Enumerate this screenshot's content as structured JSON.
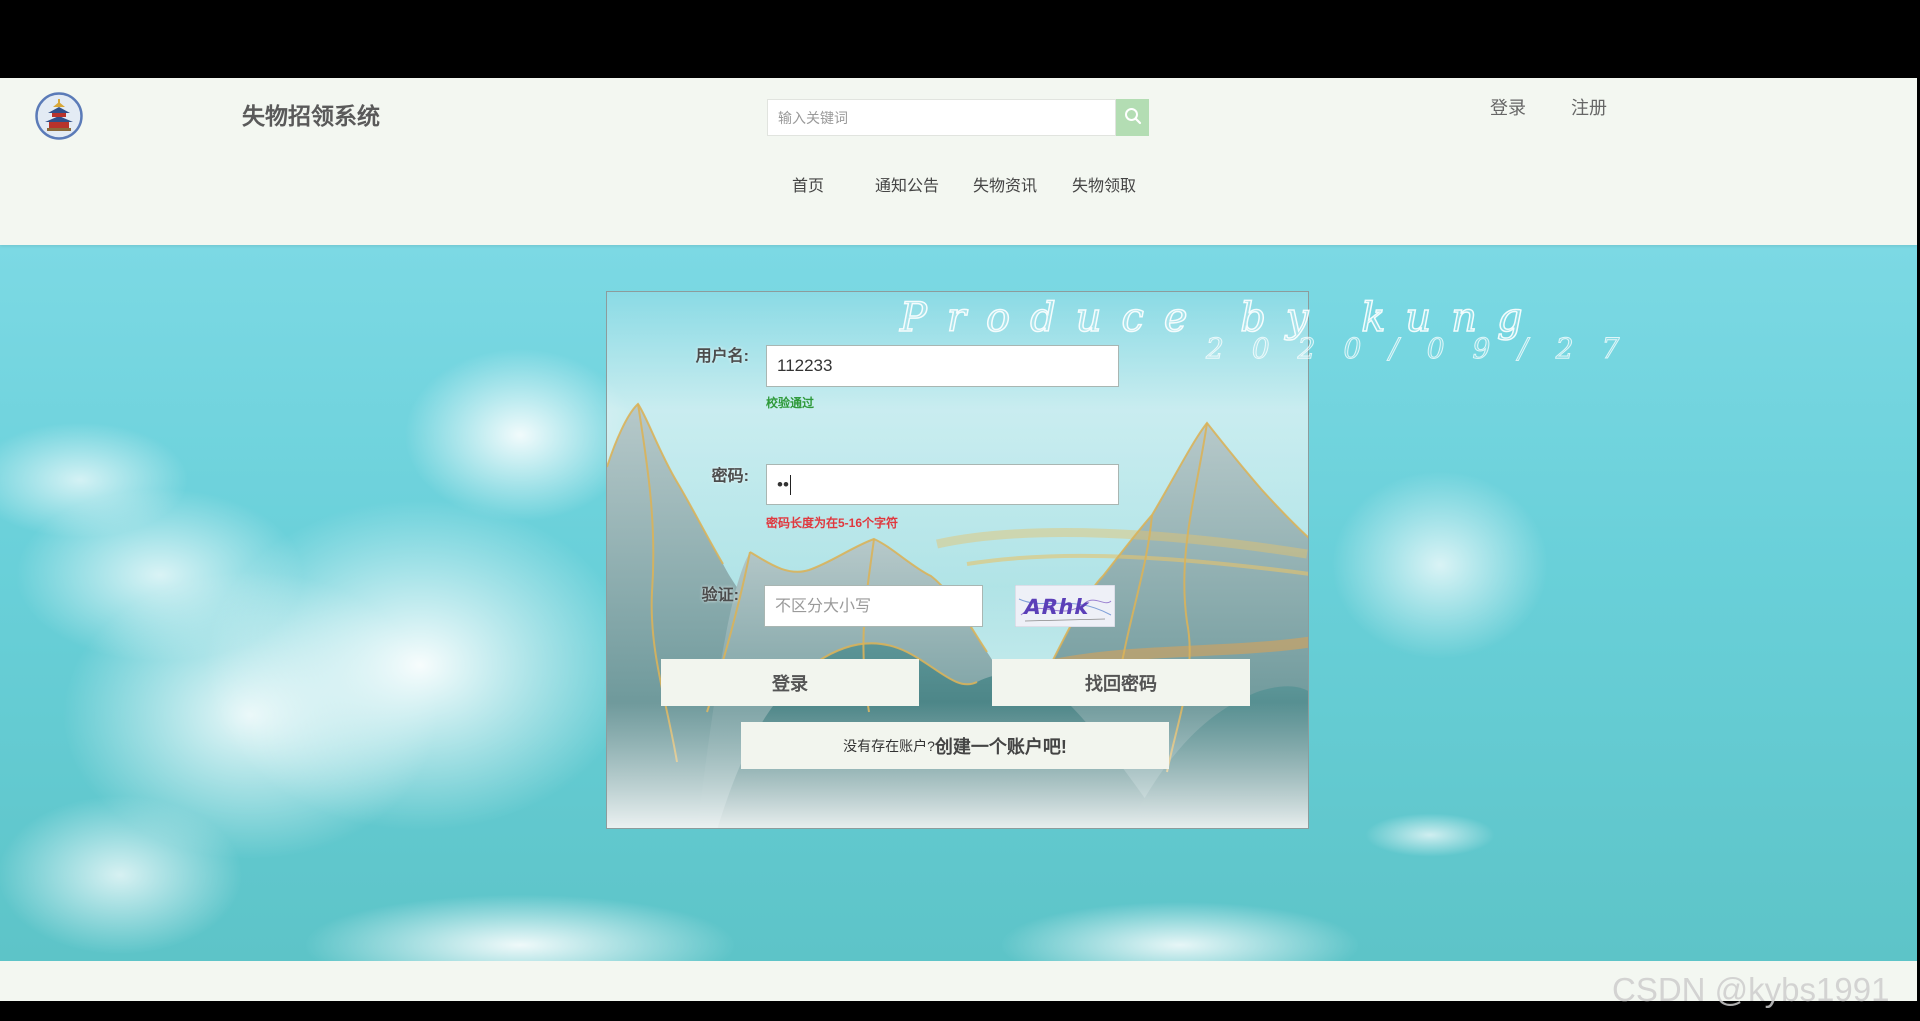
{
  "header": {
    "logo_icon": "temple-logo-icon",
    "site_title": "失物招领系统",
    "search": {
      "placeholder": "输入关键词",
      "button_icon": "search-icon"
    },
    "auth_links": [
      {
        "label": "登录"
      },
      {
        "label": "注册"
      }
    ],
    "nav": [
      {
        "label": "首页"
      },
      {
        "label": "通知公告"
      },
      {
        "label": "失物资讯"
      },
      {
        "label": "失物领取"
      }
    ]
  },
  "login_form": {
    "username": {
      "label": "用户名:",
      "value": "112233",
      "hint": "校验通过"
    },
    "password": {
      "label": "密码:",
      "masked_value": "••",
      "error": "密码长度为在5-16个字符"
    },
    "captcha": {
      "label": "验证:",
      "placeholder": "不区分大小写",
      "image_text": "ARhk"
    },
    "buttons": {
      "login": "登录",
      "forgot_password": "找回密码"
    },
    "register": {
      "prompt": "没有存在账户?",
      "link": "创建一个账户吧!"
    }
  },
  "decor": {
    "signature_line1": "Produce by kung",
    "signature_line2": "2020/09/27"
  },
  "watermark": "CSDN @kybs1991",
  "colors": {
    "header_bg": "#f3f7f1",
    "search_button": "#b3ddb3",
    "hint_ok": "#2f9a3a",
    "error": "#e0383e",
    "button_bg": "#f2f5ee",
    "sky": "#69d0d9",
    "mountain_gold": "#d9b25a"
  }
}
